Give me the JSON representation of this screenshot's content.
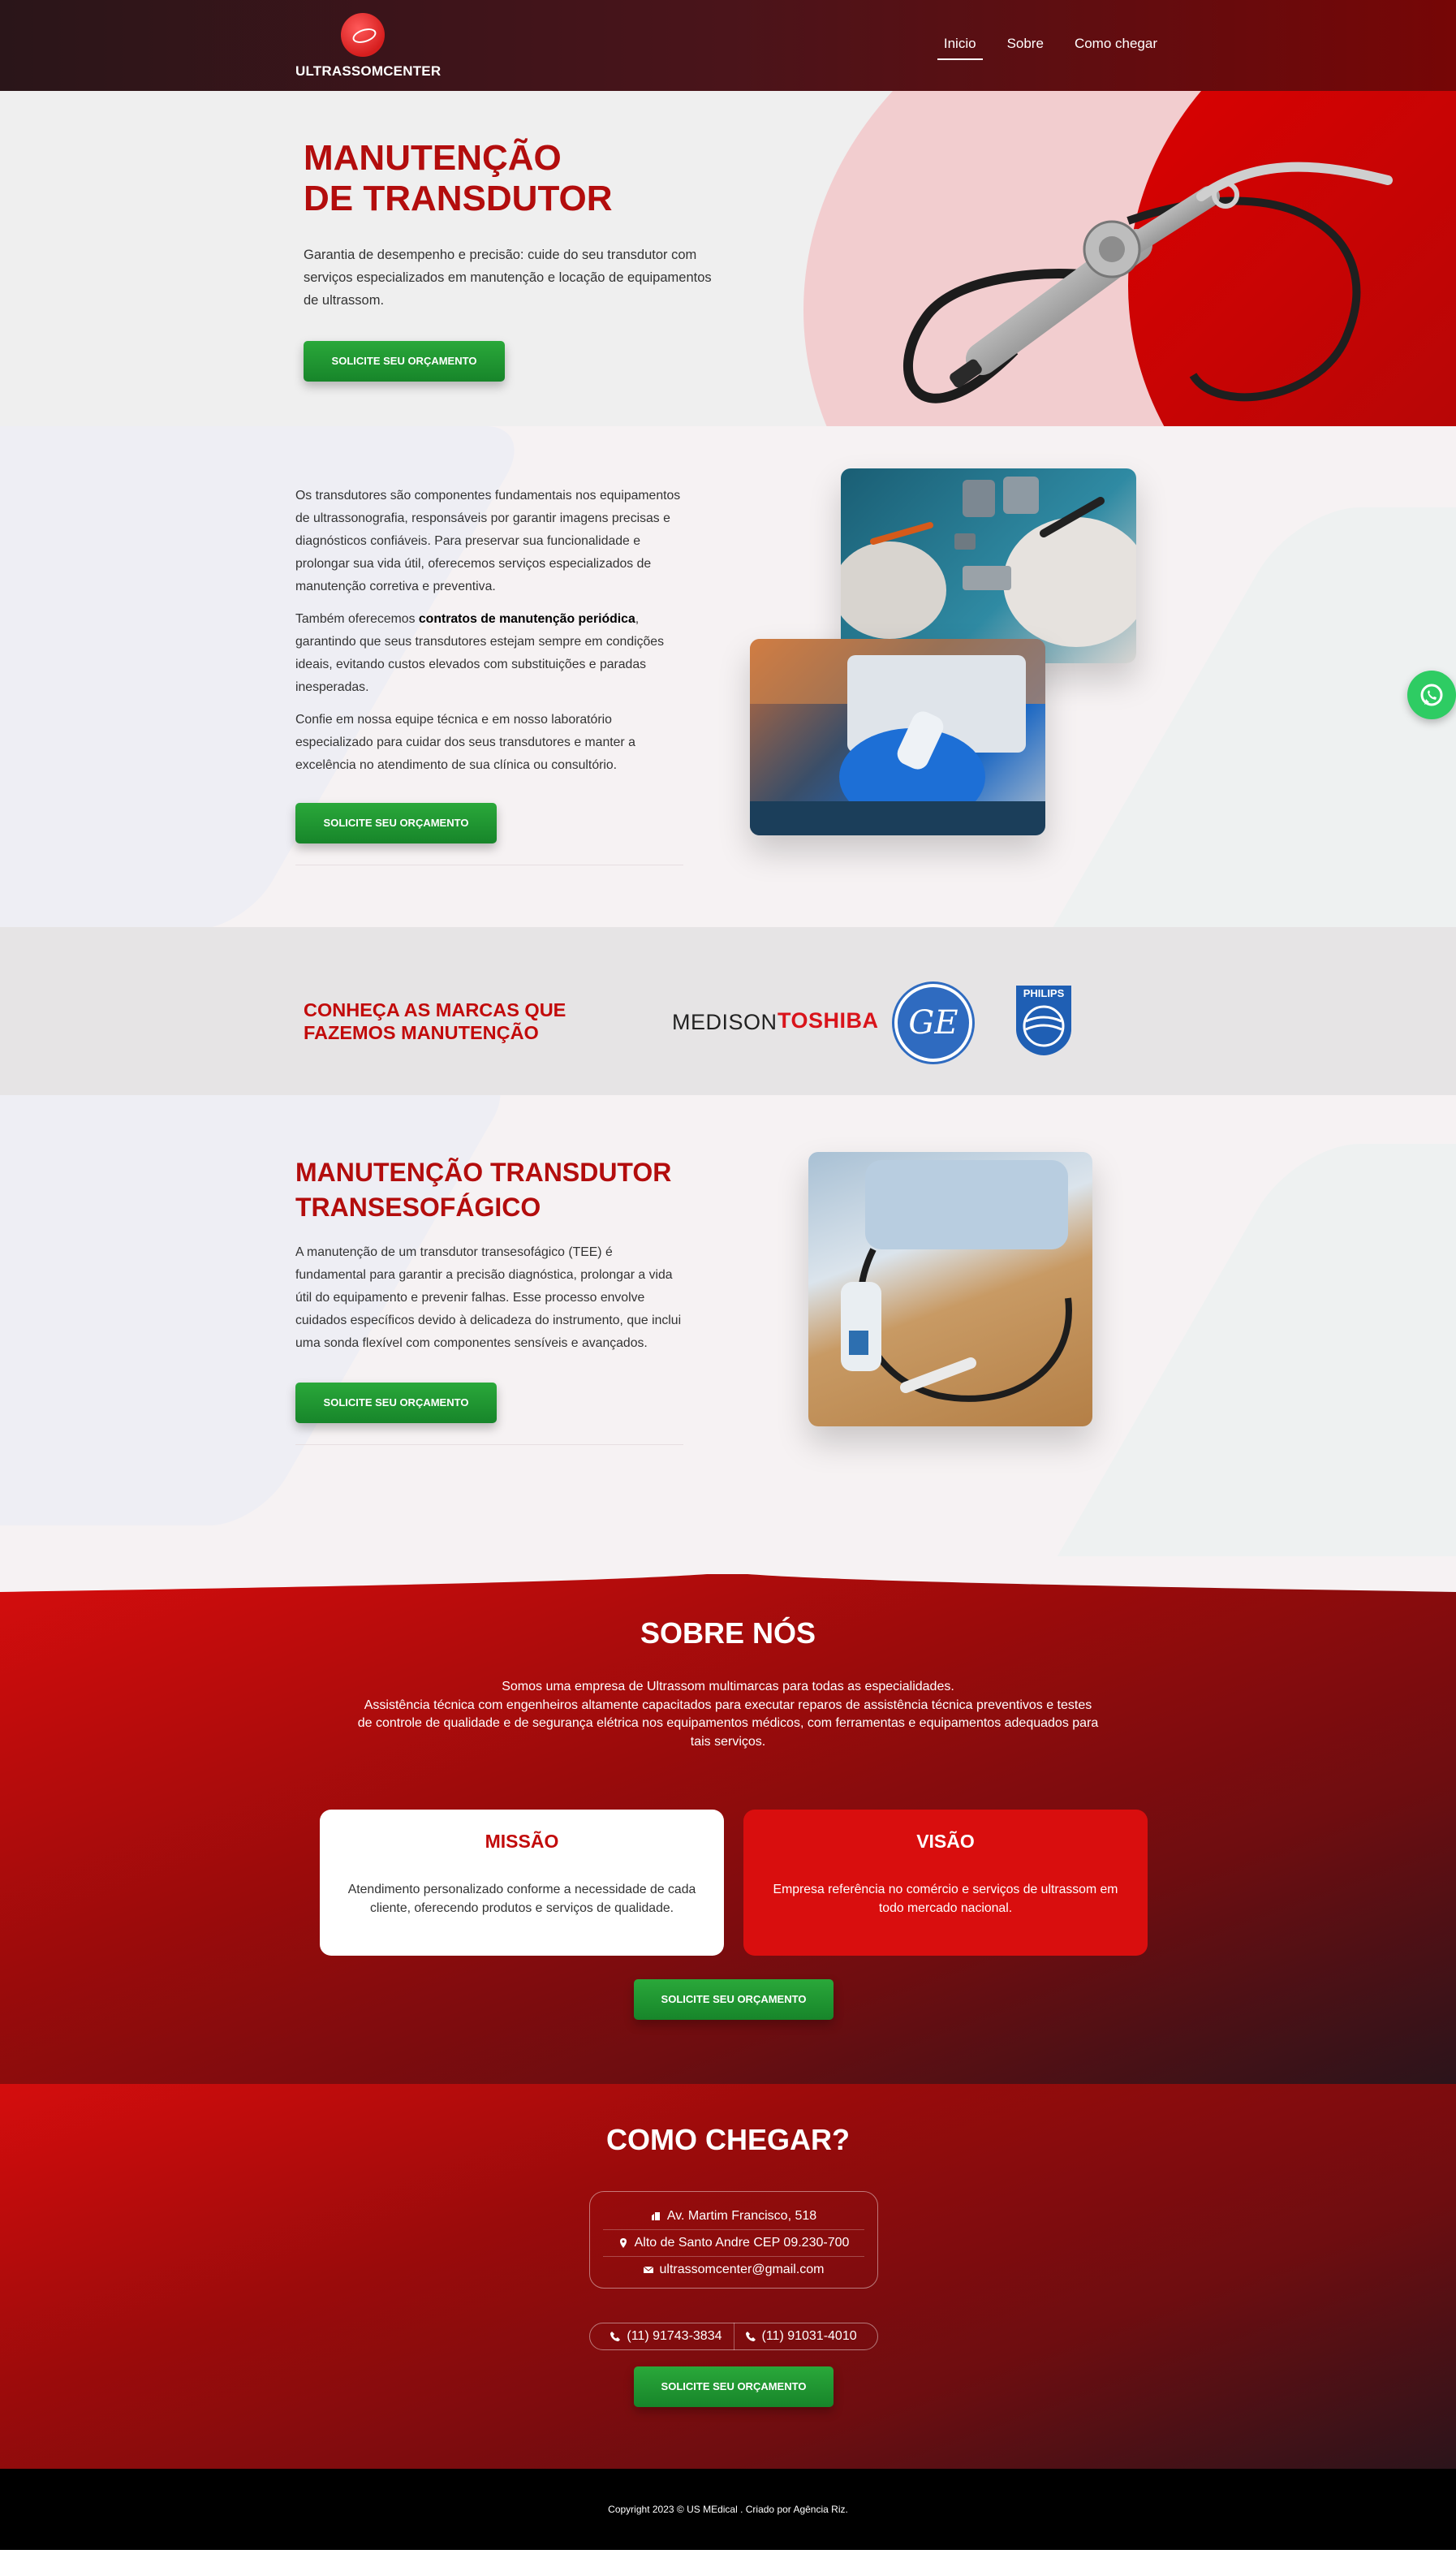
{
  "nav": {
    "brand": "ULTRASSOMCENTER",
    "items": [
      {
        "label": "Inicio",
        "active": true
      },
      {
        "label": "Sobre",
        "active": false
      },
      {
        "label": "Como chegar",
        "active": false
      }
    ]
  },
  "hero": {
    "title": "MANUTENÇÃO\nDE TRANSDUTOR",
    "description": "Garantia de desempenho e precisão: cuide do seu transdutor com serviços especializados em manutenção e locação de equipamentos de ultrassom.",
    "button": "SOLICITE SEU ORÇAMENTO"
  },
  "intro": {
    "p1": "Os transdutores são componentes fundamentais nos equipamentos de ultrassonografia, responsáveis por garantir imagens precisas e diagnósticos confiáveis. Para preservar sua funcionalidade e prolongar sua vida útil, oferecemos serviços especializados de manutenção corretiva e preventiva.",
    "p2_before": "Também oferecemos ",
    "p2_bold": "contratos de manutenção periódica",
    "p2_after": ", garantindo que seus transdutores estejam sempre em condições ideais, evitando custos elevados com substituições e paradas inesperadas.",
    "p3": "Confie em nossa equipe técnica e em nosso laboratório especializado para cuidar dos seus transdutores e manter a excelência no atendimento de sua clínica ou consultório.",
    "button": "SOLICITE SEU ORÇAMENTO"
  },
  "brands": {
    "title": "CONHEÇA AS MARCAS QUE\nFAZEMOS MANUTENÇÃO",
    "medison": "MEDISON",
    "toshiba": "TOSHIBA",
    "ge": "GE",
    "philips": "PHILIPS"
  },
  "tee": {
    "title": "MANUTENÇÃO TRANSDUTOR\nTRANSESOFÁGICO",
    "description": "A manutenção de um transdutor transesofágico (TEE) é fundamental para garantir a precisão diagnóstica, prolongar a vida útil do equipamento e prevenir falhas. Esse processo envolve cuidados específicos devido à delicadeza do instrumento, que inclui uma sonda flexível com componentes sensíveis e avançados.",
    "button": "SOLICITE SEU ORÇAMENTO"
  },
  "about": {
    "title": "SOBRE NÓS",
    "line1": "Somos uma empresa de Ultrassom multimarcas para todas as especialidades.",
    "line2": "Assistência técnica com engenheiros altamente capacitados para executar reparos de assistência técnica preventivos e testes de controle de qualidade e de segurança elétrica nos equipamentos médicos, com ferramentas e equipamentos adequados para tais serviços.",
    "mission_title": "MISSÃO",
    "mission_text": "Atendimento personalizado conforme a necessidade de cada cliente, oferecendo produtos e serviços de qualidade.",
    "vision_title": "VISÃO",
    "vision_text": "Empresa referência no comércio e serviços de ultrassom em todo mercado nacional.",
    "button": "SOLICITE SEU ORÇAMENTO"
  },
  "location": {
    "title": "COMO CHEGAR?",
    "address": "Av. Martim Francisco, 518",
    "district": "Alto de Santo Andre CEP 09.230-700",
    "email": "ultrassomcenter@gmail.com",
    "phone1": "(11) 91743-3834",
    "phone2": "(11) 91031-4010",
    "button": "SOLICITE SEU ORÇAMENTO"
  },
  "footer": {
    "copyright": "Copyright 2023 © US MEdical . Criado por Agência Riz."
  },
  "colors": {
    "primary_red": "#b30d0d",
    "accent_red": "#d90e0e",
    "button_green": "#1f9a32",
    "whatsapp": "#2ecc63"
  }
}
